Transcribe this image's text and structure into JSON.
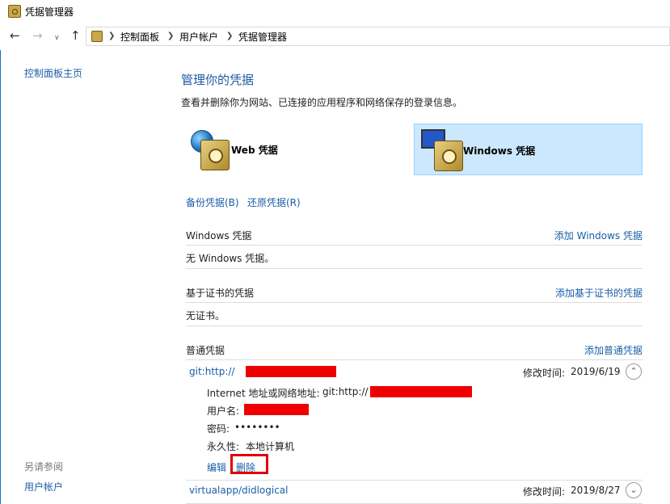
{
  "window": {
    "title": "凭据管理器"
  },
  "nav": {
    "breadcrumb": [
      "控制面板",
      "用户帐户",
      "凭据管理器"
    ]
  },
  "sidebar": {
    "home": "控制面板主页",
    "see_also_label": "另请参阅",
    "see_also_items": [
      "用户帐户"
    ]
  },
  "main": {
    "heading": "管理你的凭据",
    "description": "查看并删除你为网站、已连接的应用程序和网络保存的登录信息。",
    "cards": [
      {
        "label": "Web 凭据",
        "selected": false
      },
      {
        "label": "Windows 凭据",
        "selected": true
      }
    ],
    "backup_link": "备份凭据(B)",
    "restore_link": "还原凭据(R)",
    "sections": {
      "windows": {
        "title": "Windows 凭据",
        "action": "添加 Windows 凭据",
        "empty": "无 Windows 凭据。"
      },
      "cert": {
        "title": "基于证书的凭据",
        "action": "添加基于证书的凭据",
        "empty": "无证书。"
      },
      "generic": {
        "title": "普通凭据",
        "action": "添加普通凭据"
      }
    },
    "credentials": [
      {
        "name": "git:http://",
        "modified_label": "修改时间:",
        "modified": "2019/6/19",
        "expanded": true,
        "details": {
          "address_label": "Internet 地址或网络地址:",
          "address_value": "git:http://",
          "username_label": "用户名:",
          "password_label": "密码:",
          "password_value": "••••••••",
          "persistence_label": "永久性:",
          "persistence_value": "本地计算机"
        },
        "edit": "编辑",
        "delete": "删除"
      },
      {
        "name": "virtualapp/didlogical",
        "modified_label": "修改时间:",
        "modified": "2019/8/27",
        "expanded": false
      }
    ]
  },
  "colors": {
    "link": "#1a5ea8",
    "selected_bg": "#cce8ff",
    "highlight_box": "#e00000"
  }
}
